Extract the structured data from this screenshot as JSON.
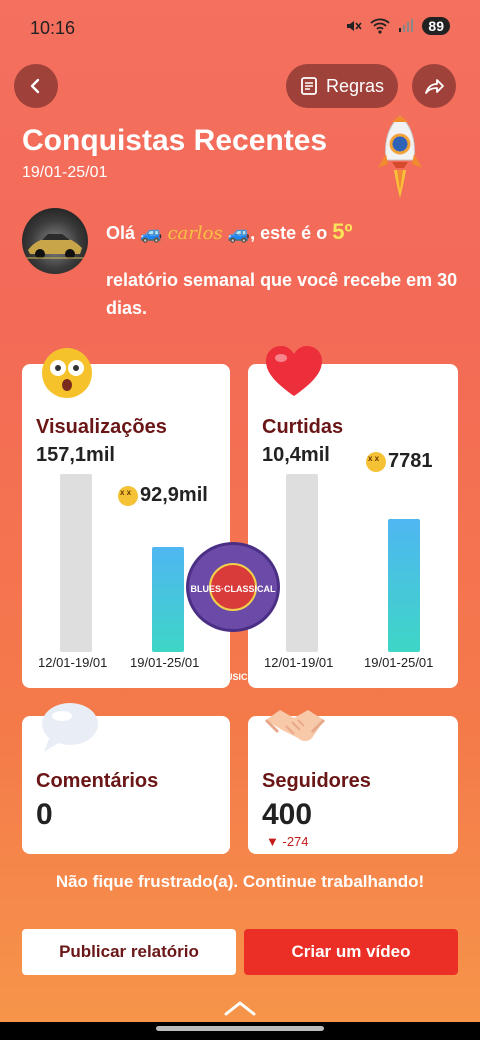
{
  "status_bar": {
    "time": "10:16",
    "battery": "89"
  },
  "header": {
    "rules_label": "Regras"
  },
  "title": "Conquistas Recentes",
  "date_range": "19/01-25/01",
  "greeting": {
    "prefix": "Olá",
    "name": "carlos",
    "middle": ", este é o",
    "number": "5º",
    "line2": "relatório semanal que você recebe em 30 dias."
  },
  "cards": {
    "views": {
      "label": "Visualizações",
      "prev_value": "157,1mil",
      "cur_value": "92,9mil",
      "prev_period": "12/01-19/01",
      "cur_period": "19/01-25/01",
      "prev_level": 157.1,
      "cur_level": 92.9
    },
    "likes": {
      "label": "Curtidas",
      "prev_value": "10,4mil",
      "cur_value": "7781",
      "prev_period": "12/01-19/01",
      "cur_period": "19/01-25/01",
      "prev_level": 10.4,
      "cur_level": 7.781
    },
    "comments": {
      "label": "Comentários",
      "value": "0"
    },
    "followers": {
      "label": "Seguidores",
      "value": "400",
      "delta": "-274"
    }
  },
  "sticker": {
    "text": "BLUES·CLASSICAL MUSIC"
  },
  "encouragement": "Não fique frustrado(a). Continue trabalhando!",
  "buttons": {
    "publish": "Publicar relatório",
    "create": "Criar um vídeo"
  },
  "colors": {
    "accent": "#ec2f26",
    "bar_gradient_top": "#4fb6f2",
    "bar_gradient_bottom": "#3ed6c6",
    "label": "#6b1616"
  }
}
